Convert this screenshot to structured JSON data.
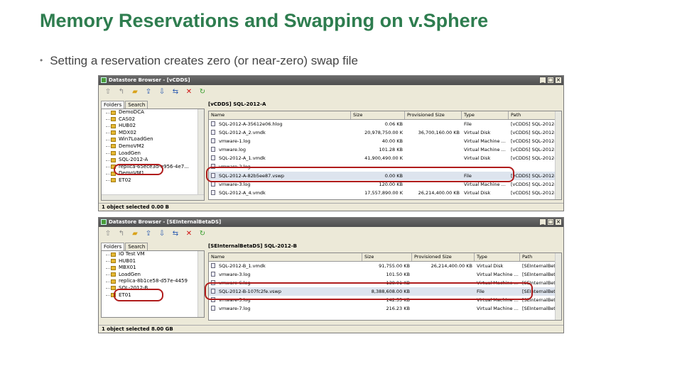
{
  "slide": {
    "title": "Memory Reservations and Swapping on v.Sphere",
    "bullet": "Setting a reservation creates zero (or near-zero) swap file"
  },
  "colors": {
    "title": "#2e7d4f",
    "titlebar": "#555555",
    "highlight": "#b01c1c"
  },
  "browser1": {
    "title": "Datastore Browser - [vCDDS]",
    "tabs": [
      "Folders",
      "Search"
    ],
    "folders": [
      "DemoDCA",
      "CAS02",
      "HUB02",
      "MDX02",
      "Win7LoadGen",
      "DemoVM2",
      "LoadGen",
      "SQL-2012-A",
      "replica-65ece3d-e956-4e7...",
      "DemoVM1",
      "ET02"
    ],
    "path": "[vCDDS] SQL-2012-A",
    "columns": [
      "Name",
      "Size",
      "Provisioned Size",
      "Type",
      "Path"
    ],
    "files": [
      {
        "name": "SQL-2012-A-35612e06.hlog",
        "size": "0.06 KB",
        "prov": "",
        "type": "File",
        "path": "[vCDDS] SQL-2012-A",
        "icon": "file-icon"
      },
      {
        "name": "SQL-2012-A_2.vmdk",
        "size": "20,978,750.00 K",
        "prov": "36,700,160.00 KB",
        "type": "Virtual Disk",
        "path": "[vCDDS] SQL-2012-A",
        "icon": "disk-icon"
      },
      {
        "name": "vmware-1.log",
        "size": "40.00 KB",
        "prov": "",
        "type": "Virtual Machine ...",
        "path": "[vCDDS] SQL-2012-A",
        "icon": "log-icon"
      },
      {
        "name": "vmware.log",
        "size": "101.28 KB",
        "prov": "",
        "type": "Virtual Machine ...",
        "path": "[vCDDS] SQL-2012-A",
        "icon": "log-icon"
      },
      {
        "name": "SQL-2012-A_1.vmdk",
        "size": "41,900,490.00 K",
        "prov": "",
        "type": "Virtual Disk",
        "path": "[vCDDS] SQL-2012-A",
        "icon": "disk-icon"
      },
      {
        "name": "vmware-2.log",
        "size": "",
        "prov": "",
        "type": "",
        "path": "",
        "icon": "log-icon"
      },
      {
        "name": "SQL-2012-A-82b5ee87.vswp",
        "size": "0.00 KB",
        "prov": "",
        "type": "File",
        "path": "[vCDDS] SQL-2012-A",
        "icon": "file-icon"
      },
      {
        "name": "vmware-3.log",
        "size": "120.00 KB",
        "prov": "",
        "type": "Virtual Machine ...",
        "path": "[vCDDS] SQL-2012-A",
        "icon": "log-icon"
      },
      {
        "name": "SQL-2012-A_4.vmdk",
        "size": "17,557,890.00 K",
        "prov": "26,214,400.00 KB",
        "type": "Virtual Disk",
        "path": "[vCDDS] SQL-2012-A",
        "icon": "disk-icon"
      }
    ],
    "status": "1 object selected 0.00 B"
  },
  "browser2": {
    "title": "Datastore Browser - [SEInternalBetaDS]",
    "tabs": [
      "Folders",
      "Search"
    ],
    "folders": [
      "IO Test VM",
      "HUB01",
      "MBX01",
      "LoadGen",
      "replica-8b1ce58-d57e-4459",
      "SQL-2012-B",
      "ET01"
    ],
    "path": "[SEInternalBetaDS] SQL-2012-B",
    "columns": [
      "Name",
      "Size",
      "Provisioned Size",
      "Type",
      "Path"
    ],
    "files": [
      {
        "name": "SQL-2012-B_1.vmdk",
        "size": "91,755.00 KB",
        "prov": "26,214,400.00 KB",
        "type": "Virtual Disk",
        "path": "[SEInternalBetaDS] SQL-2012-B",
        "icon": "disk-icon"
      },
      {
        "name": "vmware-3.log",
        "size": "101.50 KB",
        "prov": "",
        "type": "Virtual Machine ...",
        "path": "[SEInternalBetaDS] SQL-2012-B",
        "icon": "log-icon"
      },
      {
        "name": "vmware-6.log",
        "size": "138.01 KB",
        "prov": "",
        "type": "Virtual Machine ...",
        "path": "[SEInternalBetaDS] SQL-2012-B",
        "icon": "log-icon"
      },
      {
        "name": "SQL-2012-B-107fc2fe.vswp",
        "size": "8,388,608.00 KB",
        "prov": "",
        "type": "File",
        "path": "[SEInternalBetaDS] SQL-2012-B",
        "icon": "file-icon"
      },
      {
        "name": "vmware-5.log",
        "size": "142.55 KB",
        "prov": "",
        "type": "Virtual Machine ...",
        "path": "[SEInternalBetaDS] SQL-2012-B",
        "icon": "log-icon"
      },
      {
        "name": "vmware-7.log",
        "size": "216.23 KB",
        "prov": "",
        "type": "Virtual Machine ...",
        "path": "[SEInternalBetaDS] SQL-2012-B",
        "icon": "log-icon"
      }
    ],
    "status": "1 object selected 8.00 GB"
  },
  "toolbar_icons": [
    "up-folder-icon",
    "parent-folder-icon",
    "new-folder-icon",
    "upload-icon",
    "download-icon",
    "move-icon",
    "delete-icon",
    "refresh-icon"
  ]
}
